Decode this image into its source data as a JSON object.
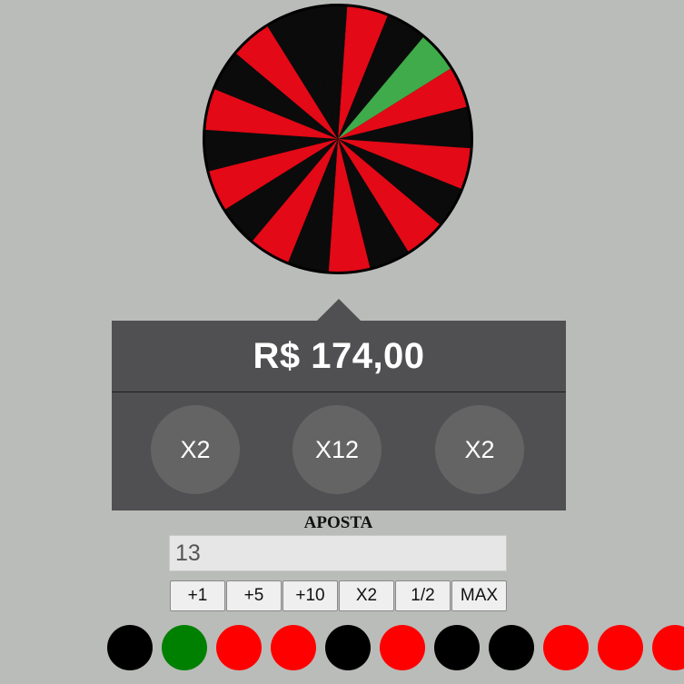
{
  "wheel": {
    "colors": {
      "red": "#e30916",
      "black": "#0b0b0b",
      "green": "#3fab4a",
      "rim": "#000000"
    },
    "segments": [
      "red",
      "black",
      "green",
      "red",
      "black",
      "red",
      "black",
      "red",
      "black",
      "red",
      "black",
      "red",
      "black",
      "red",
      "black",
      "red",
      "black",
      "red",
      "black",
      "black"
    ]
  },
  "balance": {
    "text": "R$ 174,00"
  },
  "multipliers": [
    {
      "label": "X2"
    },
    {
      "label": "X12"
    },
    {
      "label": "X2"
    }
  ],
  "bet": {
    "label": "APOSTA",
    "value": "13"
  },
  "quick_buttons": [
    {
      "label": "+1"
    },
    {
      "label": "+5"
    },
    {
      "label": "+10"
    },
    {
      "label": "X2"
    },
    {
      "label": "1/2"
    },
    {
      "label": "MAX"
    }
  ],
  "history": {
    "colors": {
      "black": "#000000",
      "green": "#008000",
      "red": "#ff0000"
    },
    "results": [
      "black",
      "green",
      "red",
      "red",
      "black",
      "red",
      "black",
      "black",
      "red",
      "red",
      "red"
    ]
  }
}
